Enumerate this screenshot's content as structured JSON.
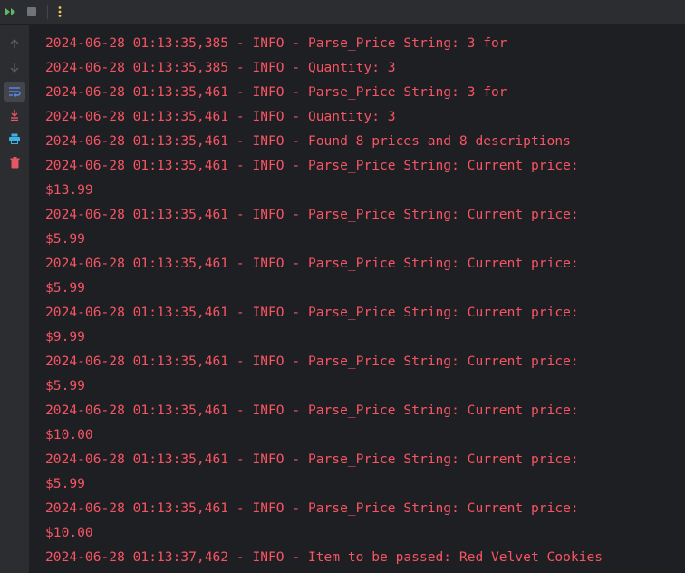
{
  "colors": {
    "log_error_text": "#f75464",
    "background": "#1e1f22",
    "toolbar_bg": "#2b2d30",
    "rerun_icon": "#5fb865",
    "stop_icon": "#6f737a",
    "more_icon": "#f2c55c",
    "print_icon": "#3fb0e2",
    "trash_icon": "#e55765",
    "soft_wrap_icon": "#548af7"
  },
  "toolbar": {
    "icons": [
      "rerun-icon",
      "stop-icon",
      "more-options-icon"
    ]
  },
  "gutter": {
    "icons": [
      "scroll-up-icon",
      "scroll-down-icon",
      "soft-wrap-icon",
      "scroll-to-end-icon",
      "print-icon",
      "clear-all-icon"
    ]
  },
  "console": {
    "partial_top_line": "                                       ,",
    "lines": [
      "2024-06-28 01:13:35,385 - INFO - Parse_Price String: 3 for",
      "2024-06-28 01:13:35,385 - INFO - Quantity: 3",
      "2024-06-28 01:13:35,461 - INFO - Parse_Price String: 3 for",
      "2024-06-28 01:13:35,461 - INFO - Quantity: 3",
      "2024-06-28 01:13:35,461 - INFO - Found 8 prices and 8 descriptions",
      "2024-06-28 01:13:35,461 - INFO - Parse_Price String: Current price:",
      "$13.99",
      "2024-06-28 01:13:35,461 - INFO - Parse_Price String: Current price:",
      "$5.99",
      "2024-06-28 01:13:35,461 - INFO - Parse_Price String: Current price:",
      "$5.99",
      "2024-06-28 01:13:35,461 - INFO - Parse_Price String: Current price:",
      "$9.99",
      "2024-06-28 01:13:35,461 - INFO - Parse_Price String: Current price:",
      "$5.99",
      "2024-06-28 01:13:35,461 - INFO - Parse_Price String: Current price:",
      "$10.00",
      "2024-06-28 01:13:35,461 - INFO - Parse_Price String: Current price:",
      "$5.99",
      "2024-06-28 01:13:35,461 - INFO - Parse_Price String: Current price:",
      "$10.00",
      "2024-06-28 01:13:37,462 - INFO - Item to be passed: Red Velvet Cookies"
    ]
  }
}
